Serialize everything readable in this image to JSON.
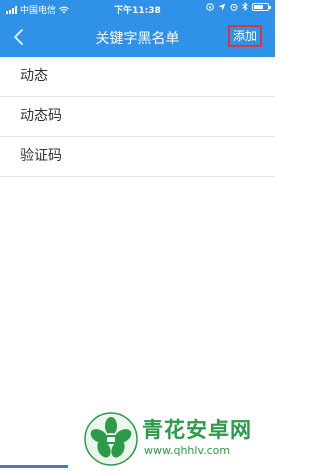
{
  "status_bar": {
    "carrier": "中国电信",
    "time": "下午11:38",
    "icons": [
      "signal-icon",
      "wifi-icon",
      "lock-rotation-icon",
      "location-icon",
      "alarm-icon",
      "bluetooth-icon",
      "battery-icon"
    ]
  },
  "navbar": {
    "title": "关键字黑名单",
    "add_label": "添加",
    "back_icon": "chevron-left-icon"
  },
  "keywords": [
    {
      "label": "动态"
    },
    {
      "label": "动态码"
    },
    {
      "label": "验证码"
    }
  ],
  "watermark": {
    "name": "青花安卓网",
    "url": "www.qhhlv.com"
  },
  "colors": {
    "header_bg": "#2f92e8",
    "highlight_border": "#e0343a",
    "watermark_green": "#2c9a48"
  }
}
